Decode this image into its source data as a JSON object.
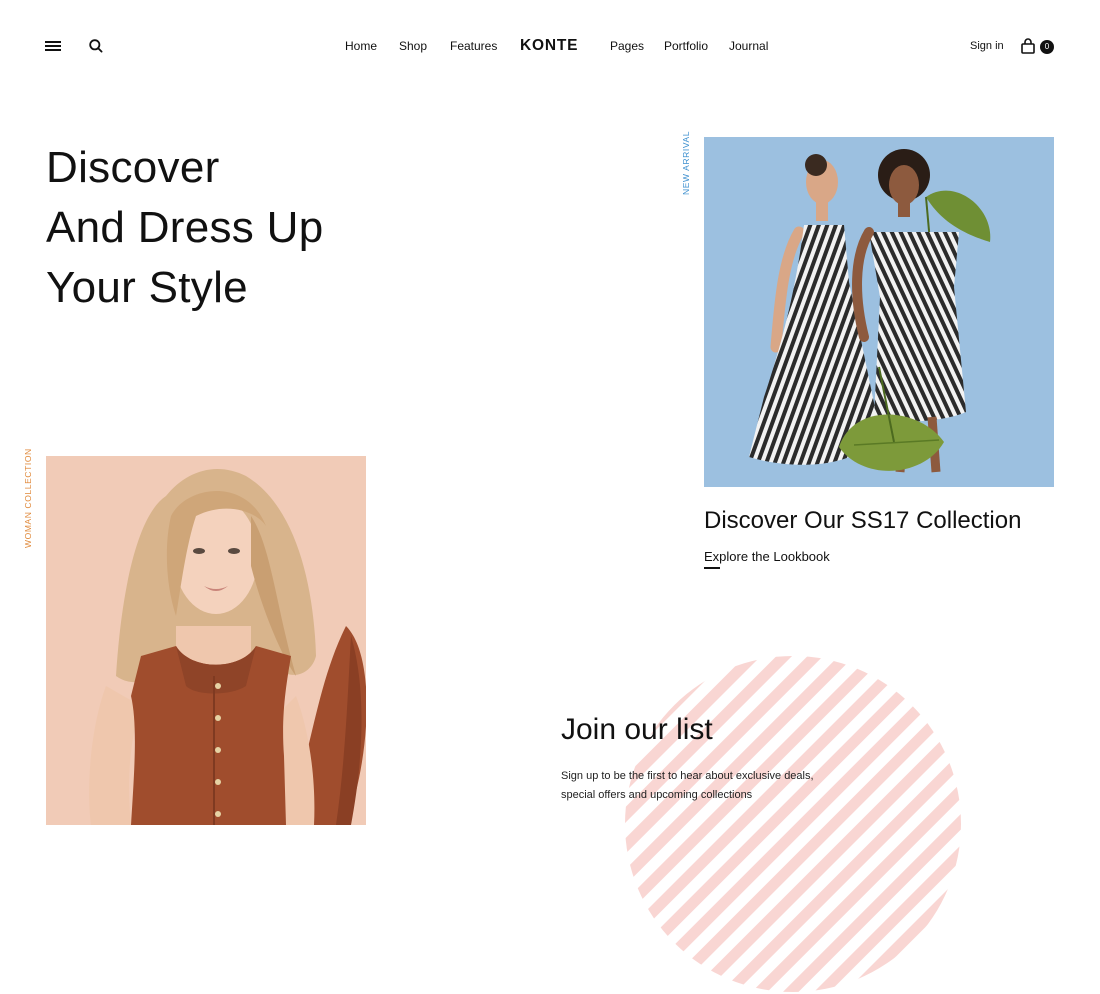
{
  "header": {
    "menu_icon": "hamburger-menu-icon",
    "search_icon": "search-icon",
    "nav": [
      "Home",
      "Shop",
      "Features",
      "Pages",
      "Portfolio",
      "Journal"
    ],
    "logo": "KONTE",
    "signin": "Sign in",
    "cart_icon": "shopping-bag-icon",
    "cart_count": "0"
  },
  "hero": {
    "lines": [
      "Discover",
      "And Dress Up",
      "Your Style"
    ]
  },
  "woman_collection": {
    "tag": "WOMAN COLLECTION",
    "tag_color": "#e08a3c"
  },
  "new_arrival": {
    "tag": "NEW ARRIVAL",
    "tag_color": "#3c8fcf",
    "title": "Discover Our SS17 Collection",
    "link": "Explore the Lookbook"
  },
  "newsletter": {
    "title": "Join our list",
    "description": "Sign up to be the first to hear about exclusive deals, special offers and upcoming collections"
  },
  "colors": {
    "accent_orange": "#e08a3c",
    "accent_blue": "#3c8fcf",
    "stripe_pink": "#f9d6d3",
    "collection_bg": "#9cc0e0",
    "woman_bg": "#f1cbb7"
  }
}
